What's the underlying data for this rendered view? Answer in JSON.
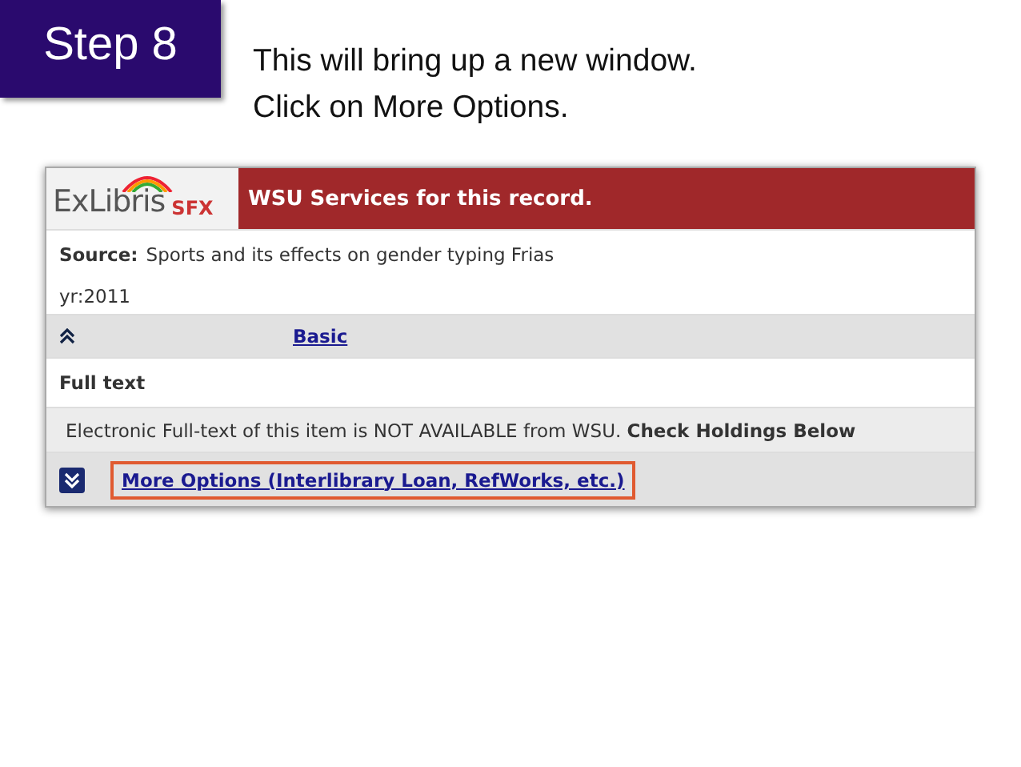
{
  "step_label": "Step 8",
  "instructions": [
    "This will bring up a new window.",
    "Click on More Options."
  ],
  "screenshot": {
    "logo": {
      "name": "ExLibris",
      "product": "SFX"
    },
    "header_title": "WSU Services for this record.",
    "source": {
      "label": "Source:",
      "value": "Sports and its effects on gender typing Frias"
    },
    "year": "yr:2011",
    "basic_link": "Basic",
    "full_text_heading": "Full text",
    "notice": "Electronic Full-text of this item is NOT AVAILABLE from WSU. **Check Holdings Below**",
    "more_options": {
      "label": "More Options (Interlibrary Loan, RefWorks, etc.)",
      "highlighted": true
    }
  }
}
